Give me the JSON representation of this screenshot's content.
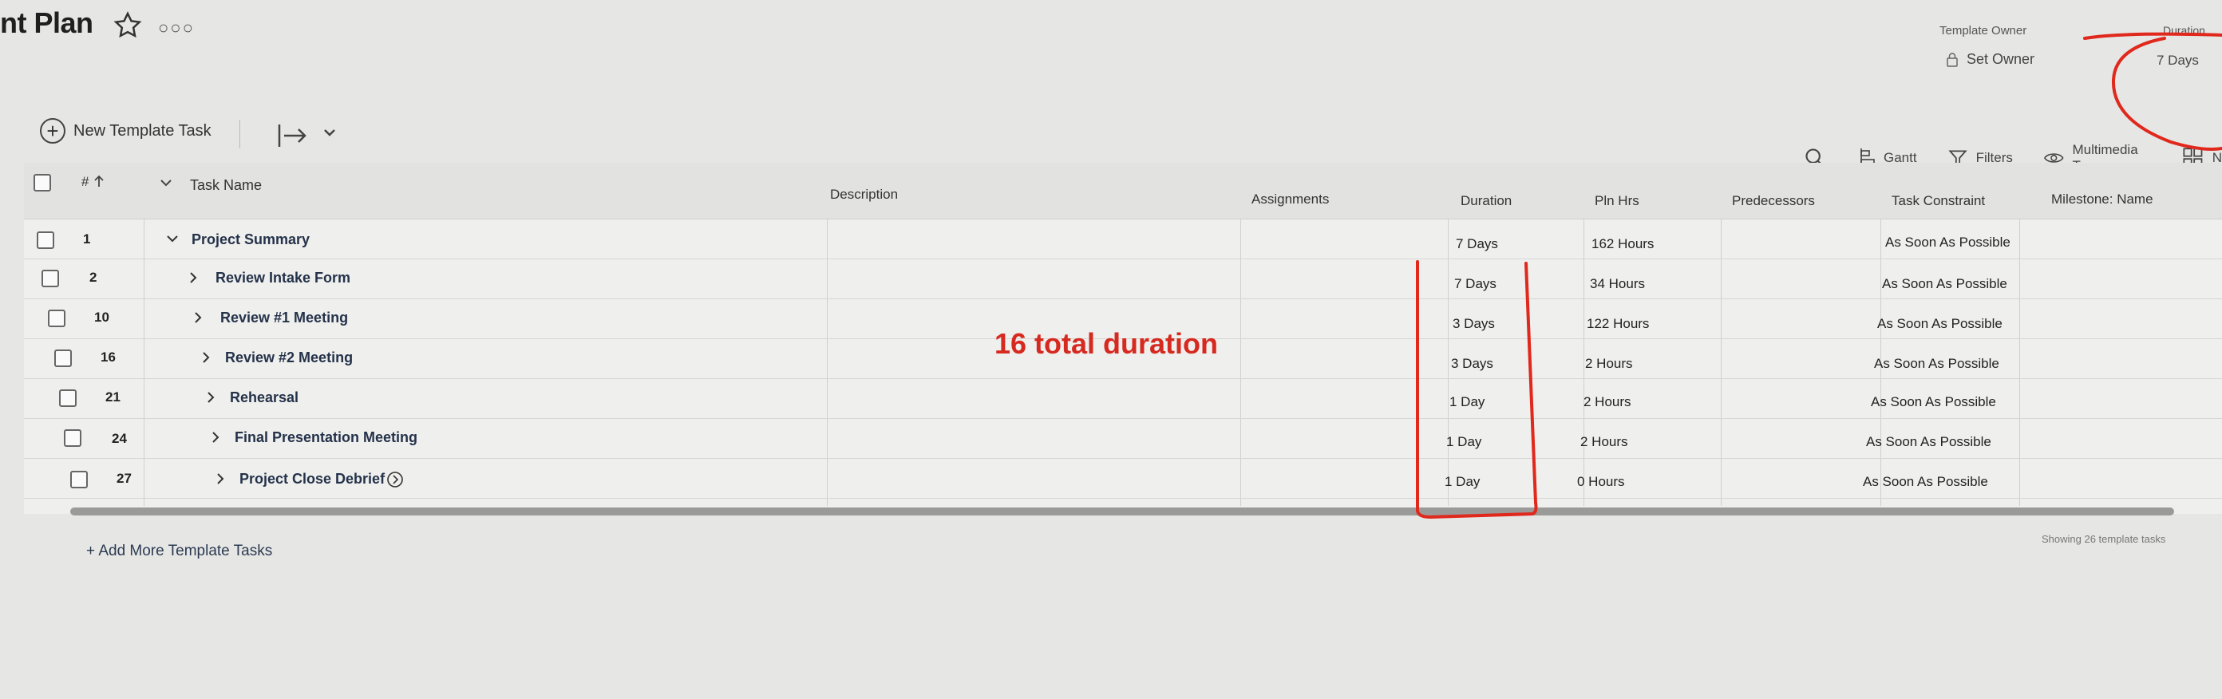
{
  "header": {
    "title": "nt Plan",
    "template_owner_label": "Template Owner",
    "owner_value": "Set Owner",
    "duration_label": "Duration",
    "duration_value": "7 Days"
  },
  "toolbar": {
    "new_task_label": "New Template Task"
  },
  "view_bar": {
    "gantt": "Gantt",
    "filters": "Filters",
    "view": "Multimedia Te",
    "grid_fragment": "N"
  },
  "columns": {
    "number": "#",
    "task_name": "Task Name",
    "description": "Description",
    "assignments": "Assignments",
    "duration": "Duration",
    "planned_hours": "Pln Hrs",
    "predecessors": "Predecessors",
    "task_constraint": "Task Constraint",
    "milestone": "Milestone: Name"
  },
  "rows": [
    {
      "num": "1",
      "name": "Project Summary",
      "duration": "7 Days",
      "hours": "162 Hours",
      "constraint": "As Soon As Possible"
    },
    {
      "num": "2",
      "name": "Review Intake Form",
      "duration": "7 Days",
      "hours": "34 Hours",
      "constraint": "As Soon As Possible"
    },
    {
      "num": "10",
      "name": "Review #1 Meeting",
      "duration": "3 Days",
      "hours": "122 Hours",
      "constraint": "As Soon As Possible"
    },
    {
      "num": "16",
      "name": "Review #2 Meeting",
      "duration": "3 Days",
      "hours": "2 Hours",
      "constraint": "As Soon As Possible"
    },
    {
      "num": "21",
      "name": "Rehearsal",
      "duration": "1 Day",
      "hours": "2 Hours",
      "constraint": "As Soon As Possible"
    },
    {
      "num": "24",
      "name": "Final Presentation Meeting",
      "duration": "1 Day",
      "hours": "2 Hours",
      "constraint": "As Soon As Possible"
    },
    {
      "num": "27",
      "name": "Project Close Debrief",
      "duration": "1 Day",
      "hours": "0 Hours",
      "constraint": "As Soon As Possible"
    }
  ],
  "footer": {
    "add_more": "+ Add More Template Tasks",
    "showing": "Showing 26 template tasks"
  },
  "annotation": {
    "text": "16 total duration",
    "color": "#d6291f"
  }
}
